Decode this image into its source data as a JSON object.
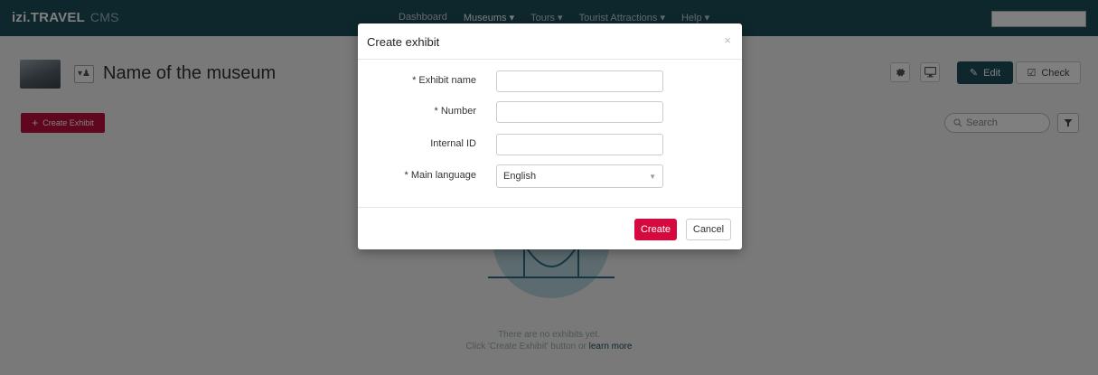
{
  "navbar": {
    "brand": "izi.TRAVEL",
    "brand_suffix": "CMS",
    "items": [
      {
        "label": "Dashboard"
      },
      {
        "label": "Museums ▾"
      },
      {
        "label": "Tours ▾"
      },
      {
        "label": "Tourist Attractions ▾"
      },
      {
        "label": "Help ▾"
      }
    ],
    "active_item": "Museums ▾"
  },
  "header": {
    "title": "Name of the museum",
    "edit_label": "Edit",
    "check_label": "Check"
  },
  "toolbar": {
    "create_exhibit_label": "Create Exhibit",
    "search_placeholder": "Search"
  },
  "empty_state": {
    "line1": "There are no exhibits yet.",
    "line2_prefix": "Click 'Create Exhibit' button or ",
    "line2_link": "learn more"
  },
  "modal": {
    "title": "Create exhibit",
    "close": "×",
    "fields": {
      "exhibit_name": {
        "label": "* Exhibit name",
        "value": ""
      },
      "number": {
        "label": "* Number",
        "value": ""
      },
      "internal_id": {
        "label": "Internal ID",
        "value": ""
      },
      "main_language": {
        "label": "* Main language",
        "value": "English"
      }
    },
    "create_label": "Create",
    "cancel_label": "Cancel"
  },
  "colors": {
    "navbar": "#1d4e5b",
    "primary_red": "#d5093e",
    "accent_teal": "#1d4e5b"
  }
}
